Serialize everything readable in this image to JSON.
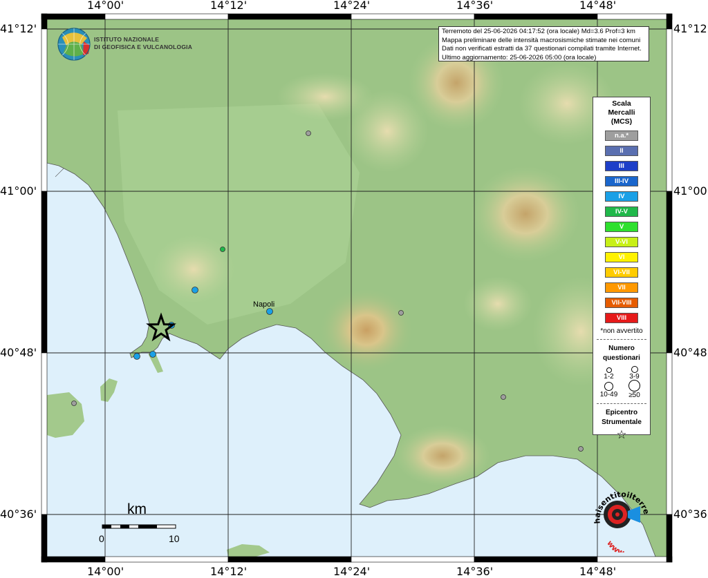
{
  "map": {
    "lon_ticks": [
      "14°00'",
      "14°12'",
      "14°24'",
      "14°36'",
      "14°48'"
    ],
    "lat_ticks": [
      "41°12'",
      "41°00'",
      "40°48'",
      "40°36'"
    ],
    "place_label": "Napoli"
  },
  "header": {
    "institute_line1": "ISTITUTO NAZIONALE",
    "institute_line2": "DI GEOFISICA E VULCANOLOGIA"
  },
  "info": {
    "line1": "Terremoto del 25-06-2026 04:17:52 (ora locale) Md=3.6 Prof=3 km",
    "line2": "Mappa preliminare delle intensità macrosismiche stimate nei comuni",
    "line3": "Dati non verificati estratti da 37 questionari compilati tramite Internet.",
    "line4": "Ultimo aggiornamento: 25-06-2026 05:00 (ora locale)"
  },
  "legend": {
    "title_line1": "Scala",
    "title_line2": "Mercalli",
    "title_line3": "(MCS)",
    "classes": [
      {
        "label": "n.a.*",
        "color": "#9e9e9e"
      },
      {
        "label": "II",
        "color": "#5a6fb0"
      },
      {
        "label": "III",
        "color": "#1e3fc8"
      },
      {
        "label": "III-IV",
        "color": "#1a66cc"
      },
      {
        "label": "IV",
        "color": "#1aa0e6"
      },
      {
        "label": "IV-V",
        "color": "#20b84a"
      },
      {
        "label": "V",
        "color": "#2ee02e"
      },
      {
        "label": "V-VI",
        "color": "#c8f016"
      },
      {
        "label": "VI",
        "color": "#fff200"
      },
      {
        "label": "VI-VII",
        "color": "#ffcc00"
      },
      {
        "label": "VII",
        "color": "#ff9900"
      },
      {
        "label": "VII-VIII",
        "color": "#e65c00"
      },
      {
        "label": "VIII",
        "color": "#e61a1a"
      }
    ],
    "not_felt_note": "*non avvertito",
    "questionnaire_title_line1": "Numero",
    "questionnaire_title_line2": "questionari",
    "q_sizes": [
      "1-2",
      "3-9",
      "10-49",
      "≥50"
    ],
    "epicenter_line1": "Epicentro",
    "epicenter_line2": "Strumentale"
  },
  "scale_bar": {
    "unit": "km",
    "start": "0",
    "end": "10"
  },
  "brand": {
    "text_top": "haisentitoilterremoto.it",
    "text_bottom": "www."
  },
  "observations": [
    {
      "mcs": "n.a.*",
      "count_class": "1-2"
    },
    {
      "mcs": "IV-V",
      "count_class": "1-2"
    },
    {
      "mcs": "IV",
      "count_class": "3-9"
    },
    {
      "mcs": "IV",
      "count_class": "3-9"
    },
    {
      "mcs": "IV",
      "count_class": "3-9"
    },
    {
      "mcs": "IV",
      "count_class": "3-9"
    },
    {
      "mcs": "IV",
      "count_class": "3-9"
    },
    {
      "mcs": "n.a.*",
      "count_class": "1-2"
    },
    {
      "mcs": "n.a.*",
      "count_class": "1-2"
    },
    {
      "mcs": "n.a.*",
      "count_class": "1-2"
    },
    {
      "mcs": "n.a.*",
      "count_class": "1-2"
    }
  ]
}
